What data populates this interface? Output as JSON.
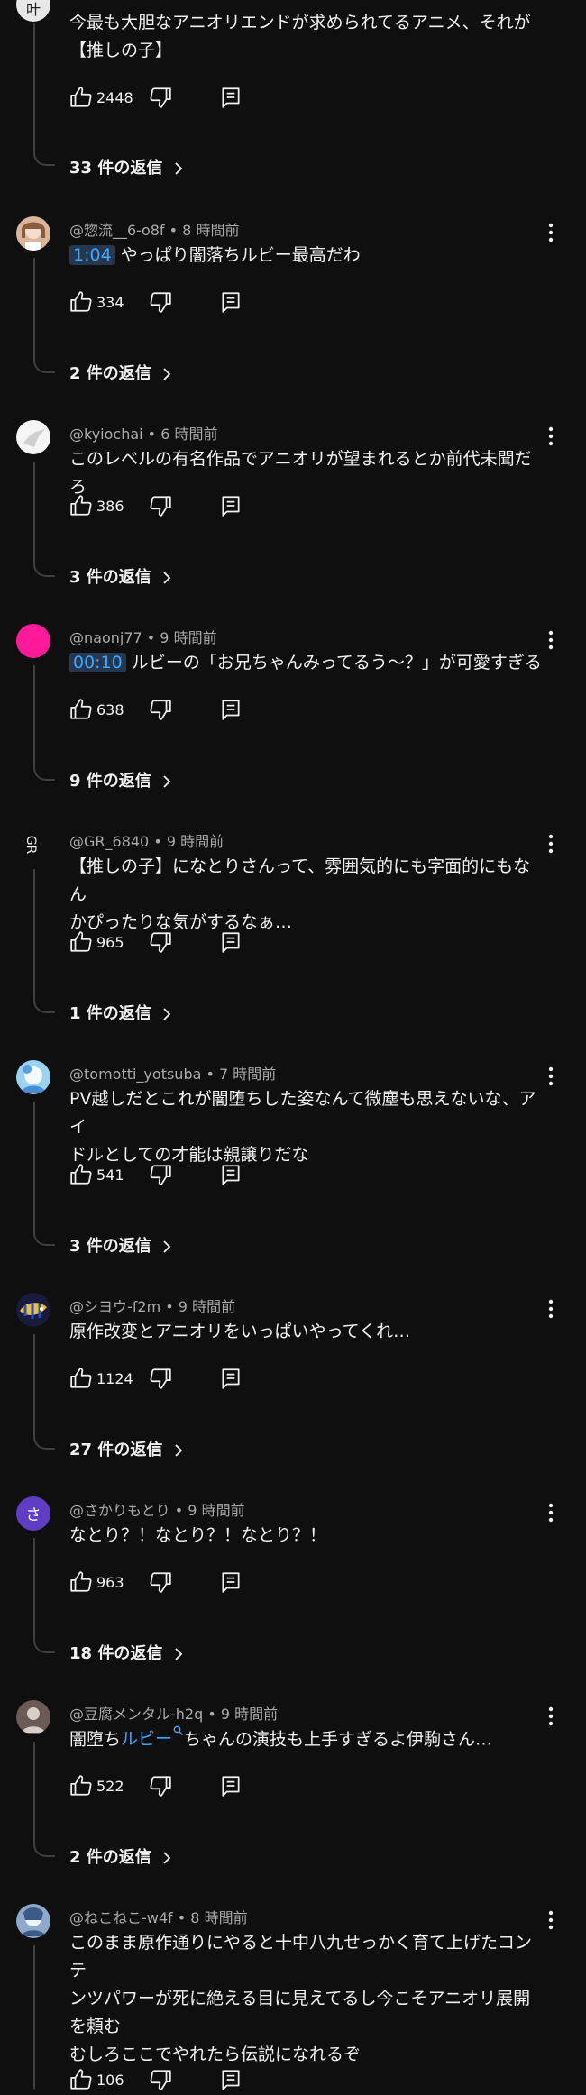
{
  "top": {
    "text": "今最も大胆なアニオリエンドが求められてるアニメ、それが【推しの子】",
    "lines": [
      "今最も大胆なアニオリエンドが求められてるアニメ、それが",
      "【推しの子】"
    ],
    "likes": "2448",
    "replies": "33 件の返信"
  },
  "comments": [
    {
      "author": "@惣流__6-o8f",
      "time": "8 時間前",
      "timestamp": "1:04",
      "text": "やっぱり闇落ちルビー最高だわ",
      "likes": "334",
      "replies": "2 件の返信"
    },
    {
      "author": "@kyiochai",
      "time": "6 時間前",
      "text": "このレベルの有名作品でアニオリが望まれるとか前代未聞だろ",
      "likes": "386",
      "replies": "3 件の返信"
    },
    {
      "author": "@naonj77",
      "time": "9 時間前",
      "timestamp": "00:10",
      "text": "ルビーの「お兄ちゃんみってるう～？」が可愛すぎる",
      "likes": "638",
      "replies": "9 件の返信"
    },
    {
      "author": "@GR_6840",
      "time": "9 時間前",
      "lines": [
        "【推しの子】になとりさんって、雰囲気的にも字面的にもなん",
        "かぴったりな気がするなぁ…"
      ],
      "likes": "965",
      "replies": "1 件の返信"
    },
    {
      "author": "@tomotti_yotsuba",
      "time": "7 時間前",
      "lines": [
        "PV越しだとこれが闇堕ちした姿なんて微塵も思えないな、アイ",
        "ドルとしての才能は親譲りだな"
      ],
      "likes": "541",
      "replies": "3 件の返信"
    },
    {
      "author": "@シヨウ-f2m",
      "time": "9 時間前",
      "text": "原作改変とアニオリをいっぱいやってくれ…",
      "likes": "1124",
      "replies": "27 件の返信"
    },
    {
      "author": "@さかりもとり",
      "time": "9 時間前",
      "avatar_letter": "さ",
      "text": "なとり？！なとり？！なとり？！",
      "likes": "963",
      "replies": "18 件の返信"
    },
    {
      "author": "@豆腐メンタル-h2q",
      "time": "9 時間前",
      "text_before": "闇堕ち",
      "link_text": "ルビー",
      "text_after": "ちゃんの演技も上手すぎるよ伊駒さん…",
      "likes": "522",
      "replies": "2 件の返信"
    },
    {
      "author": "@ねこねこ-w4f",
      "time": "8 時間前",
      "lines": [
        "このまま原作通りにやると十中八九せっかく育て上げたコンテ",
        "ンツパワーが死に絶える目に見えてるし今こそアニオリ展開",
        "を頼む",
        "むしろここでやれたら伝説になれるぞ"
      ],
      "likes": "106"
    }
  ],
  "colors": {
    "background": "#0f0f0f",
    "text": "#f1f1f1",
    "meta": "#aaaaaa",
    "link": "#3ea6ff",
    "accent_pink": "#ff1a9a",
    "accent_purple": "#5f3dc4"
  },
  "icons": [
    "thumb-up-icon",
    "thumb-down-icon",
    "reply-icon",
    "chevron-right-icon",
    "more-vert-icon"
  ]
}
